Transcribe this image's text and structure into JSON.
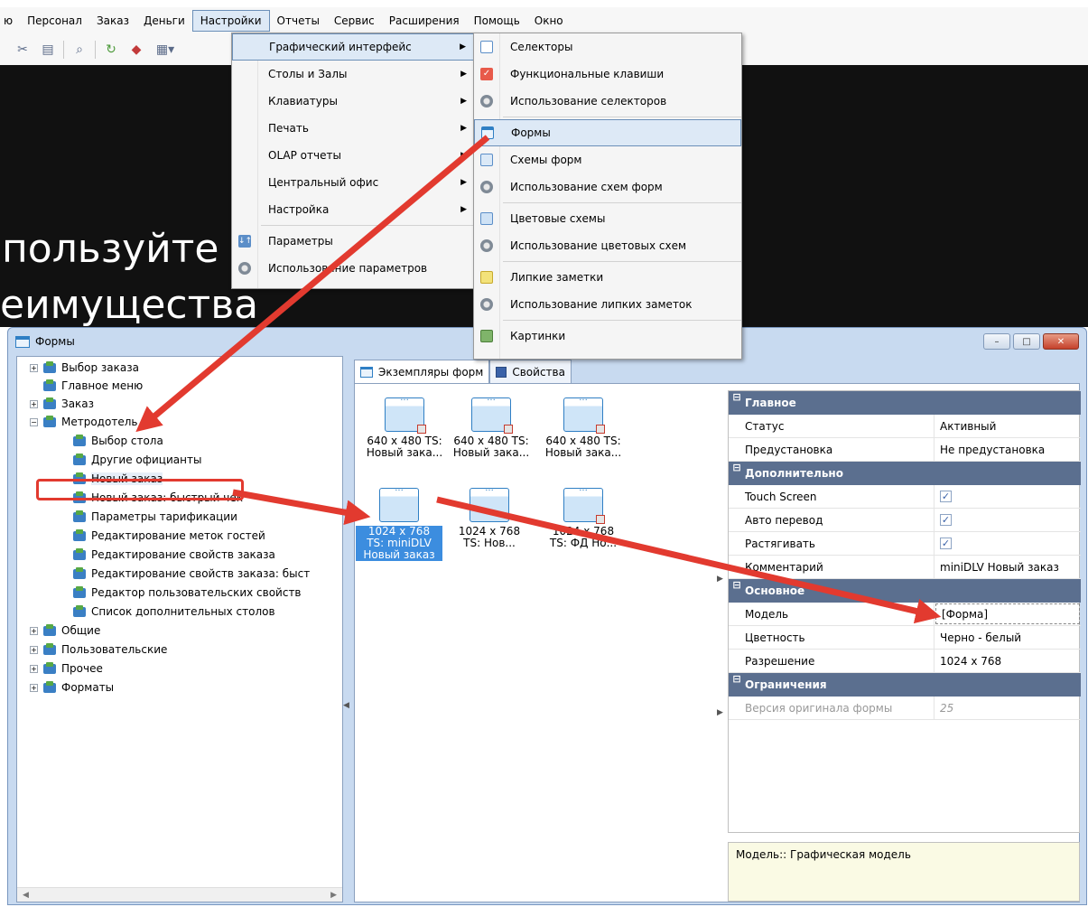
{
  "menubar": {
    "items": [
      {
        "label": "ю"
      },
      {
        "label": "Персонал"
      },
      {
        "label": "Заказ"
      },
      {
        "label": "Деньги"
      },
      {
        "label": "Настройки"
      },
      {
        "label": "Отчеты"
      },
      {
        "label": "Сервис"
      },
      {
        "label": "Расширения"
      },
      {
        "label": "Помощь"
      },
      {
        "label": "Окно"
      }
    ],
    "active_index": 4
  },
  "toolbar": {
    "buttons": [
      "cut-icon",
      "paste-icon",
      "search-icon",
      "refresh-icon",
      "color-icon",
      "table-dropdown-icon"
    ]
  },
  "background": {
    "line1": "пользуйте",
    "line2": "еимущества"
  },
  "settings_menu": {
    "items": [
      {
        "label": "Графический интерфейс",
        "submenu": true,
        "highlighted": true
      },
      {
        "label": "Столы и Залы",
        "submenu": true
      },
      {
        "label": "Клавиатуры",
        "submenu": true
      },
      {
        "label": "Печать",
        "submenu": true
      },
      {
        "label": "OLAP отчеты",
        "submenu": true
      },
      {
        "label": "Центральный офис",
        "submenu": true
      },
      {
        "label": "Настройка",
        "submenu": true
      },
      {
        "label": "Параметры",
        "icon": "parameters-icon"
      },
      {
        "label": "Использование параметров",
        "icon": "gear-icon"
      }
    ]
  },
  "gui_submenu": {
    "items": [
      {
        "label": "Селекторы",
        "icon": "selectors-icon"
      },
      {
        "label": "Функциональные клавиши",
        "icon": "function-keys-icon"
      },
      {
        "label": "Использование селекторов",
        "icon": "gear-icon"
      },
      {
        "label": "Формы",
        "icon": "form-icon",
        "highlighted": true
      },
      {
        "label": "Схемы форм",
        "icon": "form-schemes-icon"
      },
      {
        "label": "Использование схем форм",
        "icon": "gear-icon"
      },
      {
        "label": "Цветовые схемы",
        "icon": "color-schemes-icon"
      },
      {
        "label": "Использование цветовых схем",
        "icon": "gear-icon"
      },
      {
        "label": "Липкие заметки",
        "icon": "sticky-notes-icon"
      },
      {
        "label": "Использование липких заметок",
        "icon": "gear-icon"
      },
      {
        "label": "Картинки",
        "icon": "pictures-icon"
      }
    ]
  },
  "forms_window": {
    "title": "Формы",
    "buttons": {
      "minimize": "–",
      "maximize": "□",
      "close": "✕"
    },
    "tree": [
      {
        "label": "Выбор заказа",
        "level": 0,
        "expander": "+"
      },
      {
        "label": "Главное меню",
        "level": 0,
        "expander": ""
      },
      {
        "label": "Заказ",
        "level": 0,
        "expander": "+"
      },
      {
        "label": "Метродотель",
        "level": 0,
        "expander": "−"
      },
      {
        "label": "Выбор стола",
        "level": 1
      },
      {
        "label": "Другие официанты",
        "level": 1
      },
      {
        "label": "Новый заказ",
        "level": 1,
        "selected": true
      },
      {
        "label": "Новый заказ: быстрый чек",
        "level": 1
      },
      {
        "label": "Параметры тарификации",
        "level": 1
      },
      {
        "label": "Редактирование меток гостей",
        "level": 1
      },
      {
        "label": "Редактирование свойств заказа",
        "level": 1
      },
      {
        "label": "Редактирование свойств заказа: быст",
        "level": 1
      },
      {
        "label": "Редактор пользовательских свойств",
        "level": 1
      },
      {
        "label": "Список дополнительных столов",
        "level": 1
      },
      {
        "label": "Общие",
        "level": 0,
        "expander": "+"
      },
      {
        "label": "Пользовательские",
        "level": 0,
        "expander": "+"
      },
      {
        "label": "Прочее",
        "level": 0,
        "expander": "+"
      },
      {
        "label": "Форматы",
        "level": 0,
        "expander": "+"
      }
    ],
    "tabs": [
      {
        "label": "Экземпляры форм",
        "active": true
      },
      {
        "label": "Свойства",
        "active": false
      }
    ],
    "instances": [
      {
        "line1": "640 x 480 TS:",
        "line2": "Новый зака..."
      },
      {
        "line1": "640 x 480 TS:",
        "line2": "Новый зака..."
      },
      {
        "line1": "640 x 480 TS:",
        "line2": "Новый зака..."
      },
      {
        "line1": "1024 x 768",
        "line2": "TS: miniDLV",
        "line3": "Новый заказ",
        "selected": true
      },
      {
        "line1": "1024 x 768",
        "line2": "TS: Нов..."
      },
      {
        "line1": "1024 x 768",
        "line2": "TS: ФД Но..."
      }
    ],
    "properties": [
      {
        "type": "category",
        "label": "Главное"
      },
      {
        "name": "Статус",
        "value": "Активный"
      },
      {
        "name": "Предустановка",
        "value": "Не предустановка"
      },
      {
        "type": "category",
        "label": "Дополнительно"
      },
      {
        "name": "Touch Screen",
        "checkbox": true
      },
      {
        "name": "Авто перевод",
        "checkbox": true
      },
      {
        "name": "Растягивать",
        "checkbox": true
      },
      {
        "name": "Комментарий",
        "value": "miniDLV Новый заказ"
      },
      {
        "type": "category",
        "label": "Основное"
      },
      {
        "name": "Модель",
        "value": "[Форма]",
        "editing": true
      },
      {
        "name": "Цветность",
        "value": "Черно - белый"
      },
      {
        "name": "Разрешение",
        "value": "1024 x 768"
      },
      {
        "type": "category",
        "label": "Ограничения"
      },
      {
        "name": "Версия оригинала формы",
        "value": "25",
        "disabled": true
      }
    ],
    "description": "Модель:: Графическая модель"
  },
  "colors": {
    "accent": "#3c8ddf",
    "annotation_red": "#e23a2f",
    "category_bg": "#5b6f8f",
    "window_frame": "#c8daf0"
  }
}
